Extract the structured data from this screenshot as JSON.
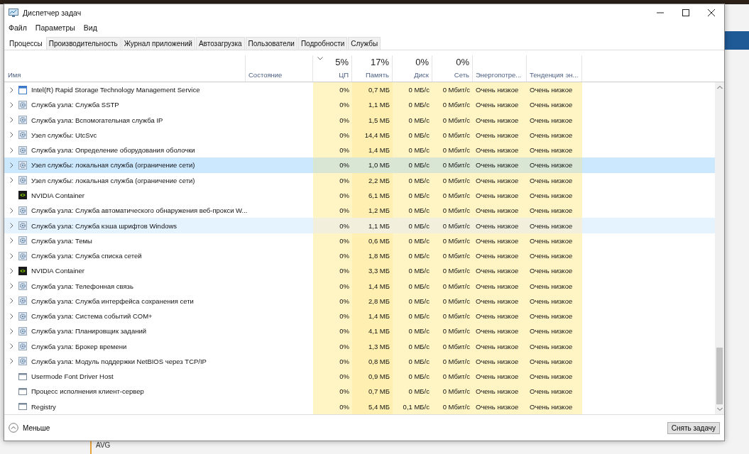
{
  "window": {
    "title": "Диспетчер задач"
  },
  "menu": [
    "Файл",
    "Параметры",
    "Вид"
  ],
  "tabs": [
    {
      "label": "Процессы",
      "selected": true
    },
    {
      "label": "Производительность",
      "selected": false
    },
    {
      "label": "Журнал приложений",
      "selected": false
    },
    {
      "label": "Автозагрузка",
      "selected": false
    },
    {
      "label": "Пользователи",
      "selected": false
    },
    {
      "label": "Подробности",
      "selected": false
    },
    {
      "label": "Службы",
      "selected": false
    }
  ],
  "table": {
    "columns": [
      {
        "label": "Имя",
        "kind": "text"
      },
      {
        "label": "Состояние",
        "kind": "text"
      },
      {
        "label": "ЦП",
        "kind": "metric",
        "total": "5%",
        "sorted": true
      },
      {
        "label": "Память",
        "kind": "metric",
        "total": "17%",
        "sorted": false
      },
      {
        "label": "Диск",
        "kind": "metric",
        "total": "0%",
        "sorted": false
      },
      {
        "label": "Сеть",
        "kind": "metric",
        "total": "0%",
        "sorted": false
      },
      {
        "label": "Энергопотре...",
        "kind": "energy"
      },
      {
        "label": "Тенденция эн...",
        "kind": "energy"
      }
    ],
    "rows": [
      {
        "kind": "app",
        "expandable": true,
        "selected": false,
        "hovered": false,
        "cells": [
          "Intel(R) Rapid Storage Technology Management Service",
          "",
          "0%",
          "0,7 МБ",
          "0 МБ/с",
          "0 Мбит/с",
          "Очень низкое",
          "Очень низкое"
        ]
      },
      {
        "kind": "service",
        "expandable": true,
        "selected": false,
        "hovered": false,
        "cells": [
          "Служба узла: Служба SSTP",
          "",
          "0%",
          "1,1 МБ",
          "0 МБ/с",
          "0 Мбит/с",
          "Очень низкое",
          "Очень низкое"
        ]
      },
      {
        "kind": "service",
        "expandable": true,
        "selected": false,
        "hovered": false,
        "cells": [
          "Служба узла: Вспомогательная служба IP",
          "",
          "0%",
          "1,5 МБ",
          "0 МБ/с",
          "0 Мбит/с",
          "Очень низкое",
          "Очень низкое"
        ]
      },
      {
        "kind": "service",
        "expandable": true,
        "selected": false,
        "hovered": false,
        "cells": [
          "Узел службы: UtcSvc",
          "",
          "0%",
          "14,4 МБ",
          "0 МБ/с",
          "0 Мбит/с",
          "Очень низкое",
          "Очень низкое"
        ]
      },
      {
        "kind": "service",
        "expandable": true,
        "selected": false,
        "hovered": false,
        "cells": [
          "Служба узла: Определение оборудования оболочки",
          "",
          "0%",
          "1,4 МБ",
          "0 МБ/с",
          "0 Мбит/с",
          "Очень низкое",
          "Очень низкое"
        ]
      },
      {
        "kind": "service",
        "expandable": true,
        "selected": true,
        "hovered": false,
        "cells": [
          "Узел службы: локальная служба (ограничение сети)",
          "",
          "0%",
          "1,0 МБ",
          "0 МБ/с",
          "0 Мбит/с",
          "Очень низкое",
          "Очень низкое"
        ]
      },
      {
        "kind": "service",
        "expandable": true,
        "selected": false,
        "hovered": false,
        "cells": [
          "Узел службы: локальная служба (ограничение сети)",
          "",
          "0%",
          "2,2 МБ",
          "0 МБ/с",
          "0 Мбит/с",
          "Очень низкое",
          "Очень низкое"
        ]
      },
      {
        "kind": "nvidia",
        "expandable": false,
        "selected": false,
        "hovered": false,
        "cells": [
          "NVIDIA Container",
          "",
          "0%",
          "6,1 МБ",
          "0 МБ/с",
          "0 Мбит/с",
          "Очень низкое",
          "Очень низкое"
        ]
      },
      {
        "kind": "service",
        "expandable": true,
        "selected": false,
        "hovered": false,
        "cells": [
          "Служба узла: Служба автоматического обнаружения веб-прокси W...",
          "",
          "0%",
          "1,2 МБ",
          "0 МБ/с",
          "0 Мбит/с",
          "Очень низкое",
          "Очень низкое"
        ]
      },
      {
        "kind": "service",
        "expandable": true,
        "selected": false,
        "hovered": true,
        "cells": [
          "Служба узла: Служба кэша шрифтов Windows",
          "",
          "0%",
          "1,1 МБ",
          "0 МБ/с",
          "0 Мбит/с",
          "Очень низкое",
          "Очень низкое"
        ]
      },
      {
        "kind": "service",
        "expandable": true,
        "selected": false,
        "hovered": false,
        "cells": [
          "Служба узла: Темы",
          "",
          "0%",
          "0,6 МБ",
          "0 МБ/с",
          "0 Мбит/с",
          "Очень низкое",
          "Очень низкое"
        ]
      },
      {
        "kind": "service",
        "expandable": true,
        "selected": false,
        "hovered": false,
        "cells": [
          "Служба узла: Служба списка сетей",
          "",
          "0%",
          "1,8 МБ",
          "0 МБ/с",
          "0 Мбит/с",
          "Очень низкое",
          "Очень низкое"
        ]
      },
      {
        "kind": "nvidia",
        "expandable": true,
        "selected": false,
        "hovered": false,
        "cells": [
          "NVIDIA Container",
          "",
          "0%",
          "3,3 МБ",
          "0 МБ/с",
          "0 Мбит/с",
          "Очень низкое",
          "Очень низкое"
        ]
      },
      {
        "kind": "service",
        "expandable": true,
        "selected": false,
        "hovered": false,
        "cells": [
          "Служба узла: Телефонная связь",
          "",
          "0%",
          "1,4 МБ",
          "0 МБ/с",
          "0 Мбит/с",
          "Очень низкое",
          "Очень низкое"
        ]
      },
      {
        "kind": "service",
        "expandable": true,
        "selected": false,
        "hovered": false,
        "cells": [
          "Служба узла: Служба интерфейса сохранения сети",
          "",
          "0%",
          "2,8 МБ",
          "0 МБ/с",
          "0 Мбит/с",
          "Очень низкое",
          "Очень низкое"
        ]
      },
      {
        "kind": "service",
        "expandable": true,
        "selected": false,
        "hovered": false,
        "cells": [
          "Служба узла: Система событий COM+",
          "",
          "0%",
          "1,4 МБ",
          "0 МБ/с",
          "0 Мбит/с",
          "Очень низкое",
          "Очень низкое"
        ]
      },
      {
        "kind": "service",
        "expandable": true,
        "selected": false,
        "hovered": false,
        "cells": [
          "Служба узла: Планировщик заданий",
          "",
          "0%",
          "4,1 МБ",
          "0 МБ/с",
          "0 Мбит/с",
          "Очень низкое",
          "Очень низкое"
        ]
      },
      {
        "kind": "service",
        "expandable": true,
        "selected": false,
        "hovered": false,
        "cells": [
          "Служба узла: Брокер времени",
          "",
          "0%",
          "1,3 МБ",
          "0 МБ/с",
          "0 Мбит/с",
          "Очень низкое",
          "Очень низкое"
        ]
      },
      {
        "kind": "service",
        "expandable": true,
        "selected": false,
        "hovered": false,
        "cells": [
          "Служба узла: Модуль поддержки NetBIOS через TCP/IP",
          "",
          "0%",
          "0,8 МБ",
          "0 МБ/с",
          "0 Мбит/с",
          "Очень низкое",
          "Очень низкое"
        ]
      },
      {
        "kind": "generic",
        "expandable": false,
        "selected": false,
        "hovered": false,
        "cells": [
          "Usermode Font Driver Host",
          "",
          "0%",
          "0,9 МБ",
          "0 МБ/с",
          "0 Мбит/с",
          "Очень низкое",
          "Очень низкое"
        ]
      },
      {
        "kind": "generic",
        "expandable": false,
        "selected": false,
        "hovered": false,
        "cells": [
          "Процесс исполнения клиент-сервер",
          "",
          "0%",
          "0,7 МБ",
          "0 МБ/с",
          "0 Мбит/с",
          "Очень низкое",
          "Очень низкое"
        ]
      },
      {
        "kind": "generic",
        "expandable": false,
        "selected": false,
        "hovered": false,
        "cells": [
          "Registry",
          "",
          "0%",
          "5,4 МБ",
          "0,1 МБ/с",
          "0 Мбит/с",
          "Очень низкое",
          "Очень низкое"
        ]
      }
    ]
  },
  "footer": {
    "toggle": "Меньше",
    "button": "Снять задачу"
  },
  "background": {
    "items": [
      "AVG"
    ]
  }
}
